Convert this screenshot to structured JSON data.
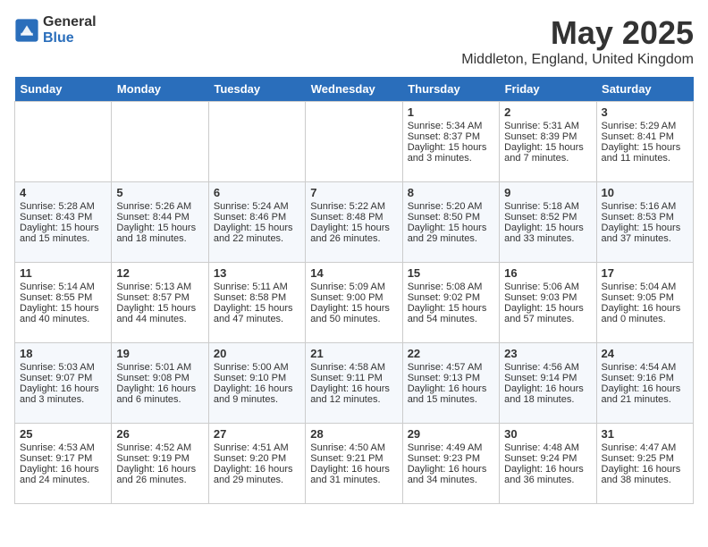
{
  "header": {
    "logo_general": "General",
    "logo_blue": "Blue",
    "title": "May 2025",
    "subtitle": "Middleton, England, United Kingdom"
  },
  "days_of_week": [
    "Sunday",
    "Monday",
    "Tuesday",
    "Wednesday",
    "Thursday",
    "Friday",
    "Saturday"
  ],
  "weeks": [
    [
      {
        "day": "",
        "info": ""
      },
      {
        "day": "",
        "info": ""
      },
      {
        "day": "",
        "info": ""
      },
      {
        "day": "",
        "info": ""
      },
      {
        "day": "1",
        "info": "Sunrise: 5:34 AM\nSunset: 8:37 PM\nDaylight: 15 hours\nand 3 minutes."
      },
      {
        "day": "2",
        "info": "Sunrise: 5:31 AM\nSunset: 8:39 PM\nDaylight: 15 hours\nand 7 minutes."
      },
      {
        "day": "3",
        "info": "Sunrise: 5:29 AM\nSunset: 8:41 PM\nDaylight: 15 hours\nand 11 minutes."
      }
    ],
    [
      {
        "day": "4",
        "info": "Sunrise: 5:28 AM\nSunset: 8:43 PM\nDaylight: 15 hours\nand 15 minutes."
      },
      {
        "day": "5",
        "info": "Sunrise: 5:26 AM\nSunset: 8:44 PM\nDaylight: 15 hours\nand 18 minutes."
      },
      {
        "day": "6",
        "info": "Sunrise: 5:24 AM\nSunset: 8:46 PM\nDaylight: 15 hours\nand 22 minutes."
      },
      {
        "day": "7",
        "info": "Sunrise: 5:22 AM\nSunset: 8:48 PM\nDaylight: 15 hours\nand 26 minutes."
      },
      {
        "day": "8",
        "info": "Sunrise: 5:20 AM\nSunset: 8:50 PM\nDaylight: 15 hours\nand 29 minutes."
      },
      {
        "day": "9",
        "info": "Sunrise: 5:18 AM\nSunset: 8:52 PM\nDaylight: 15 hours\nand 33 minutes."
      },
      {
        "day": "10",
        "info": "Sunrise: 5:16 AM\nSunset: 8:53 PM\nDaylight: 15 hours\nand 37 minutes."
      }
    ],
    [
      {
        "day": "11",
        "info": "Sunrise: 5:14 AM\nSunset: 8:55 PM\nDaylight: 15 hours\nand 40 minutes."
      },
      {
        "day": "12",
        "info": "Sunrise: 5:13 AM\nSunset: 8:57 PM\nDaylight: 15 hours\nand 44 minutes."
      },
      {
        "day": "13",
        "info": "Sunrise: 5:11 AM\nSunset: 8:58 PM\nDaylight: 15 hours\nand 47 minutes."
      },
      {
        "day": "14",
        "info": "Sunrise: 5:09 AM\nSunset: 9:00 PM\nDaylight: 15 hours\nand 50 minutes."
      },
      {
        "day": "15",
        "info": "Sunrise: 5:08 AM\nSunset: 9:02 PM\nDaylight: 15 hours\nand 54 minutes."
      },
      {
        "day": "16",
        "info": "Sunrise: 5:06 AM\nSunset: 9:03 PM\nDaylight: 15 hours\nand 57 minutes."
      },
      {
        "day": "17",
        "info": "Sunrise: 5:04 AM\nSunset: 9:05 PM\nDaylight: 16 hours\nand 0 minutes."
      }
    ],
    [
      {
        "day": "18",
        "info": "Sunrise: 5:03 AM\nSunset: 9:07 PM\nDaylight: 16 hours\nand 3 minutes."
      },
      {
        "day": "19",
        "info": "Sunrise: 5:01 AM\nSunset: 9:08 PM\nDaylight: 16 hours\nand 6 minutes."
      },
      {
        "day": "20",
        "info": "Sunrise: 5:00 AM\nSunset: 9:10 PM\nDaylight: 16 hours\nand 9 minutes."
      },
      {
        "day": "21",
        "info": "Sunrise: 4:58 AM\nSunset: 9:11 PM\nDaylight: 16 hours\nand 12 minutes."
      },
      {
        "day": "22",
        "info": "Sunrise: 4:57 AM\nSunset: 9:13 PM\nDaylight: 16 hours\nand 15 minutes."
      },
      {
        "day": "23",
        "info": "Sunrise: 4:56 AM\nSunset: 9:14 PM\nDaylight: 16 hours\nand 18 minutes."
      },
      {
        "day": "24",
        "info": "Sunrise: 4:54 AM\nSunset: 9:16 PM\nDaylight: 16 hours\nand 21 minutes."
      }
    ],
    [
      {
        "day": "25",
        "info": "Sunrise: 4:53 AM\nSunset: 9:17 PM\nDaylight: 16 hours\nand 24 minutes."
      },
      {
        "day": "26",
        "info": "Sunrise: 4:52 AM\nSunset: 9:19 PM\nDaylight: 16 hours\nand 26 minutes."
      },
      {
        "day": "27",
        "info": "Sunrise: 4:51 AM\nSunset: 9:20 PM\nDaylight: 16 hours\nand 29 minutes."
      },
      {
        "day": "28",
        "info": "Sunrise: 4:50 AM\nSunset: 9:21 PM\nDaylight: 16 hours\nand 31 minutes."
      },
      {
        "day": "29",
        "info": "Sunrise: 4:49 AM\nSunset: 9:23 PM\nDaylight: 16 hours\nand 34 minutes."
      },
      {
        "day": "30",
        "info": "Sunrise: 4:48 AM\nSunset: 9:24 PM\nDaylight: 16 hours\nand 36 minutes."
      },
      {
        "day": "31",
        "info": "Sunrise: 4:47 AM\nSunset: 9:25 PM\nDaylight: 16 hours\nand 38 minutes."
      }
    ]
  ]
}
